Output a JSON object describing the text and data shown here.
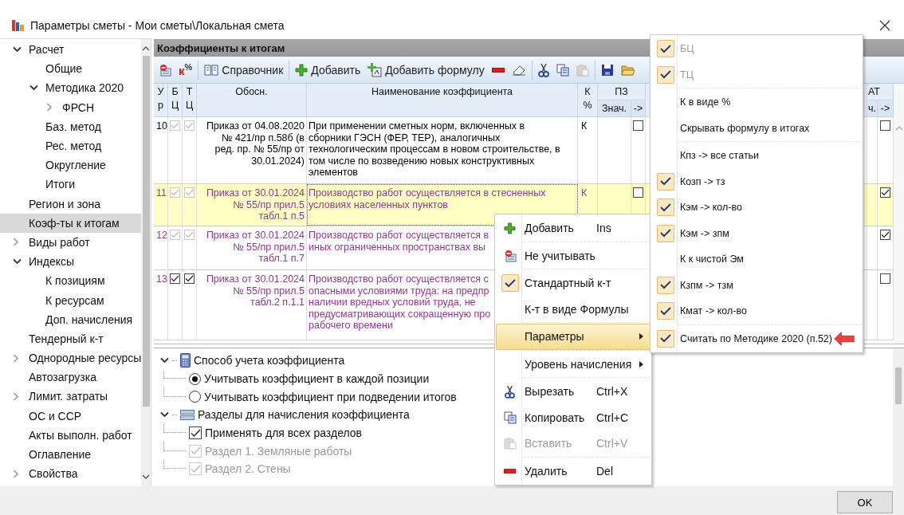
{
  "window": {
    "title": "Параметры сметы - Мои сметы\\Локальная смета"
  },
  "sidebar": {
    "items": [
      {
        "label": "Расчет",
        "selected": false,
        "expanded": true,
        "children": [
          {
            "label": "Общие",
            "selected": false
          },
          {
            "label": "Методика 2020",
            "selected": false,
            "expanded": true,
            "children": [
              {
                "label": "ФРСН",
                "selected": false,
                "expanded": false
              }
            ]
          },
          {
            "label": "Баз. метод",
            "selected": false
          },
          {
            "label": "Рес. метод",
            "selected": false
          },
          {
            "label": "Округление",
            "selected": false
          },
          {
            "label": "Итоги",
            "selected": false
          }
        ]
      },
      {
        "label": "Регион и зона",
        "selected": false
      },
      {
        "label": "Коэф-ты к итогам",
        "selected": true
      },
      {
        "label": "Виды работ",
        "selected": false,
        "expanded": false
      },
      {
        "label": "Индексы",
        "selected": false,
        "expanded": true,
        "children": [
          {
            "label": "К позициям",
            "selected": false
          },
          {
            "label": "К ресурсам",
            "selected": false
          },
          {
            "label": "Доп. начисления",
            "selected": false
          }
        ]
      },
      {
        "label": "Тендерный к-т",
        "selected": false
      },
      {
        "label": "Однородные ресурсы",
        "selected": false,
        "expanded": false
      },
      {
        "label": "Автозагрузка",
        "selected": false
      },
      {
        "label": "Лимит. затраты",
        "selected": false,
        "expanded": false
      },
      {
        "label": "ОС и ССР",
        "selected": false
      },
      {
        "label": "Акты выполн. работ",
        "selected": false
      },
      {
        "label": "Оглавление",
        "selected": false
      },
      {
        "label": "Свойства",
        "selected": false,
        "expanded": false
      }
    ]
  },
  "panel": {
    "title": "Коэффициенты к итогам"
  },
  "toolbar": {
    "k_percent": "к$^{%}$",
    "reference": "Справочник",
    "add": "Добавить",
    "add_formula": "Добавить формулу",
    "paste_disabled": true
  },
  "table": {
    "columns": [
      "У\nр",
      "Б\nЦ",
      "Т\nЦ",
      "Обосн.",
      "Наименование коэффициента",
      "К\n%"
    ],
    "groups": [
      {
        "label": "ПЗ",
        "subcolumns": [
          "Знач.",
          "->"
        ]
      },
      {
        "label": "АТ",
        "subcolumns": [
          "ч.",
          "->"
        ]
      }
    ],
    "rows": [
      {
        "number": "10",
        "bc_checked": true,
        "tc_checked": true,
        "checks_disabled": true,
        "basis": "Приказ от 04.08.2020\n№ 421/пр п.58б (в\nред. пр. № 55/пр от\n30.01.2024)",
        "name": "При применении сметных норм, включенных в\nсборники ГЭСН (ФЕР, ТЕР), аналогичных\nтехнологическим процессам в новом строительстве, в\nтом числе по возведению новых конструктивных\nэлементов",
        "k": "К",
        "pz_flag": false,
        "at_flag": false,
        "selected": false,
        "color": "#000000"
      },
      {
        "number": "11",
        "bc_checked": true,
        "tc_checked": true,
        "checks_disabled": true,
        "basis": "Приказ от 30.01.2024\n№ 55/пр прил.5\nтабл.1 п.5",
        "name": "Производство работ осуществляется в стесненных\nусловиях населенных пунктов",
        "k": "К",
        "pz_flag": false,
        "at_flag": true,
        "selected": true,
        "color": "#8e3a8e"
      },
      {
        "number": "12",
        "bc_checked": true,
        "tc_checked": true,
        "checks_disabled": true,
        "basis": "Приказ от 30.01.2024\n№ 55/пр прил.5\nтабл.1 п.7",
        "name": "Производство работ осуществляется в\nиных ограниченных пространствах вы",
        "at_flag": true,
        "selected": false,
        "color": "#8e3a8e"
      },
      {
        "number": "13",
        "bc_checked": true,
        "tc_checked": true,
        "checks_disabled": false,
        "basis": "Приказ от 30.01.2024\n№ 55/пр прил.5\nтабл.2 п.1.1",
        "name": "Производство работ осуществляется с\nопасными условиями труда: на предпр\nналичии вредных условий труда, не\nпредусматривающих сокращенную про\nрабочего времени",
        "at_flag": false,
        "selected": false,
        "color": "#8e3a8e"
      }
    ]
  },
  "options": {
    "groups": [
      {
        "label": "Способ учета коэффициента",
        "kind": "radio",
        "expanded": true,
        "children": [
          {
            "label": "Учитывать коэффициент в каждой позиции",
            "selected": true
          },
          {
            "label": "Учитывать коэффициент при подведении итогов",
            "selected": false
          }
        ]
      },
      {
        "label": "Разделы для начисления коэффициента",
        "kind": "checkbox",
        "expanded": true,
        "children": [
          {
            "label": "Применять для всех разделов",
            "checked": true,
            "disabled": false
          },
          {
            "label": "Раздел 1. Земляные работы",
            "checked": true,
            "disabled": true
          },
          {
            "label": "Раздел 2. Стены",
            "checked": true,
            "disabled": true
          }
        ]
      }
    ]
  },
  "context_menu": {
    "groups": [
      [
        {
          "label": "Добавить",
          "shortcut": "Ins",
          "checked": false,
          "disabled": false,
          "selected": false,
          "submenu": false
        }
      ],
      [
        {
          "label": "Не учитывать",
          "checked": false,
          "disabled": false,
          "selected": false,
          "submenu": false
        }
      ],
      [
        {
          "label": "Стандартный к-т",
          "checked": true,
          "disabled": false,
          "selected": false,
          "submenu": false
        },
        {
          "label": "К-т в виде Формулы",
          "checked": false,
          "disabled": false,
          "selected": false,
          "submenu": false
        }
      ],
      [
        {
          "label": "Параметры",
          "checked": false,
          "disabled": false,
          "selected": true,
          "submenu": true
        }
      ],
      [
        {
          "label": "Уровень начисления",
          "checked": false,
          "disabled": false,
          "selected": false,
          "submenu": true
        }
      ],
      [
        {
          "label": "Вырезать",
          "shortcut": "Ctrl+X",
          "checked": false,
          "disabled": false,
          "selected": false,
          "submenu": false
        },
        {
          "label": "Копировать",
          "shortcut": "Ctrl+C",
          "checked": false,
          "disabled": false,
          "selected": false,
          "submenu": false
        },
        {
          "label": "Вставить",
          "shortcut": "Ctrl+V",
          "checked": false,
          "disabled": true,
          "selected": false,
          "submenu": false
        }
      ],
      [
        {
          "label": "Удалить",
          "shortcut": "Del",
          "checked": false,
          "disabled": false,
          "selected": false,
          "submenu": false
        }
      ]
    ]
  },
  "submenu": {
    "groups": [
      [
        {
          "label": "БЦ",
          "checked": true,
          "disabled": true
        },
        {
          "label": "ТЦ",
          "checked": true,
          "disabled": true
        }
      ],
      [
        {
          "label": "К в виде %",
          "checked": false,
          "disabled": false
        },
        {
          "label": "Скрывать формулу в итогах",
          "checked": false,
          "disabled": false
        }
      ],
      [
        {
          "label": "Кпз -> все статьи",
          "checked": false,
          "disabled": false
        },
        {
          "label": "Козп -> тз",
          "checked": true,
          "disabled": false
        },
        {
          "label": "Кэм -> кол-во",
          "checked": true,
          "disabled": false
        },
        {
          "label": "Кэм -> зпм",
          "checked": true,
          "disabled": false
        },
        {
          "label": "К к чистой Эм",
          "checked": false,
          "disabled": false
        },
        {
          "label": "Кзпм -> тзм",
          "checked": true,
          "disabled": false
        },
        {
          "label": "Кмат -> кол-во",
          "checked": true,
          "disabled": false
        }
      ],
      [
        {
          "label": "Считать по Методике 2020 (п.52)",
          "checked": true,
          "disabled": false
        }
      ]
    ]
  },
  "footer": {
    "ok": "OK"
  }
}
